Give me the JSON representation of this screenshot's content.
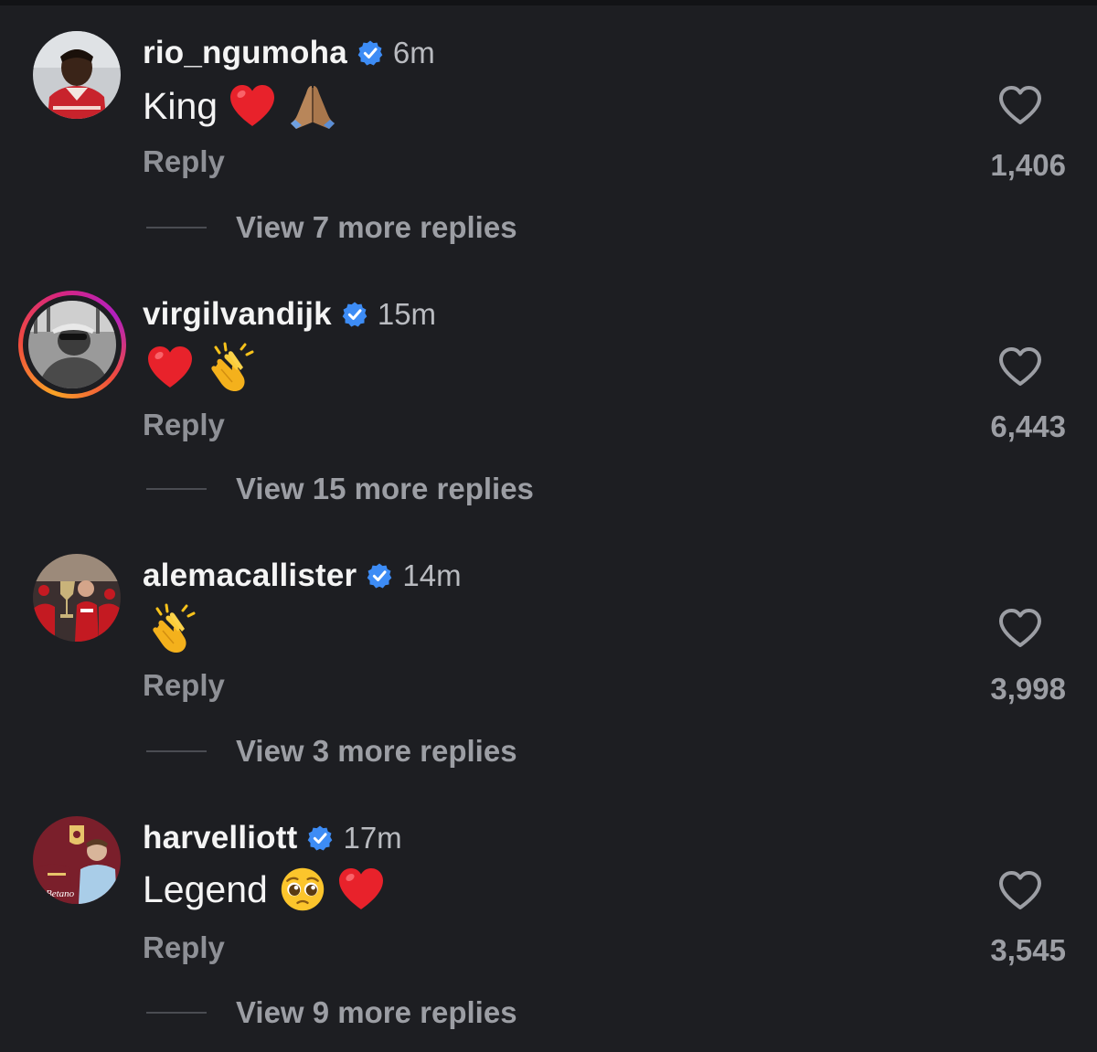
{
  "comments": [
    {
      "username": "rio_ngumoha",
      "time": "6m",
      "text": "King",
      "emojis": [
        "heart-emoji",
        "folded-hands-emoji"
      ],
      "reply_label": "Reply",
      "likes": "1,406",
      "view_more": "View 7 more replies"
    },
    {
      "username": "virgilvandijk",
      "time": "15m",
      "text": "",
      "emojis": [
        "heart-emoji",
        "clapping-hands-emoji"
      ],
      "reply_label": "Reply",
      "likes": "6,443",
      "view_more": "View 15 more replies"
    },
    {
      "username": "alemacallister",
      "time": "14m",
      "text": "",
      "emojis": [
        "clapping-hands-emoji"
      ],
      "reply_label": "Reply",
      "likes": "3,998",
      "view_more": "View 3 more replies"
    },
    {
      "username": "harvelliott",
      "time": "17m",
      "text": "Legend",
      "emojis": [
        "pleading-face-emoji",
        "heart-emoji"
      ],
      "reply_label": "Reply",
      "likes": "3,545",
      "view_more": "View 9 more replies"
    }
  ],
  "avatar_logo_text": "Betano",
  "colors": {
    "background": "#1d1e22",
    "verified": "#3d8cf5",
    "muted_text": "#9c9ea4",
    "heart_emoji": "#e8222b"
  }
}
